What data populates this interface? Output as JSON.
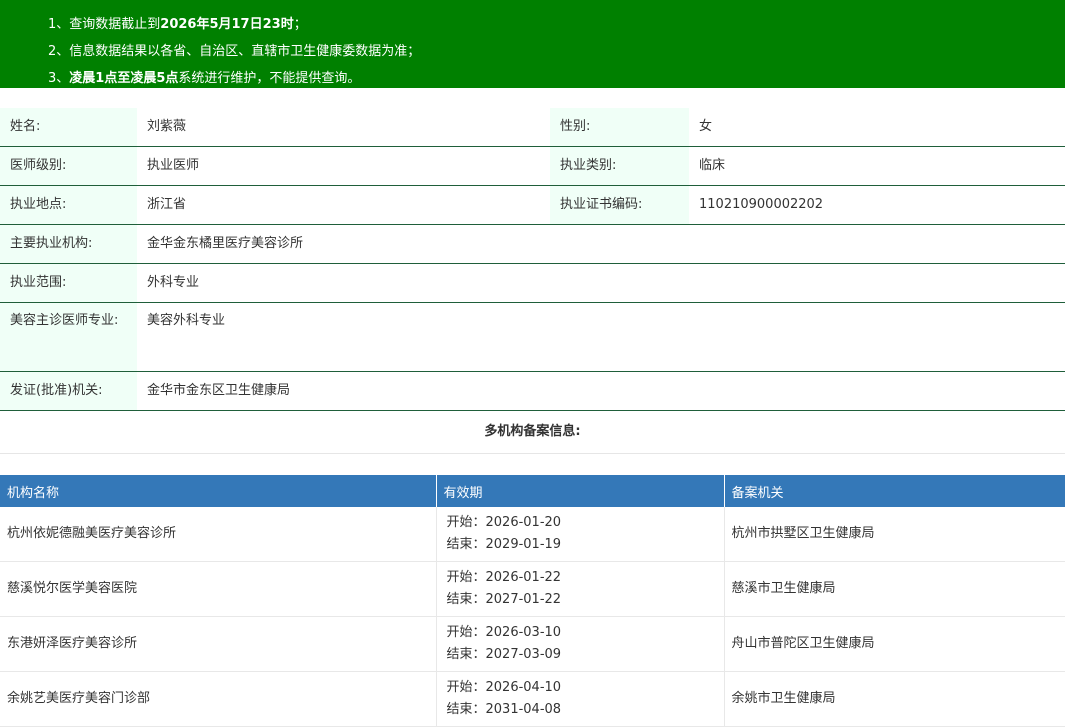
{
  "notice": {
    "line1_prefix": "1、查询数据截止到",
    "line1_bold": "2026年5月17日23时",
    "line1_suffix": "；",
    "line2": "2、信息数据结果以各省、自治区、直辖市卫生健康委数据为准；",
    "line3_prefix": "3、",
    "line3_bold": "凌晨1点至凌晨5点",
    "line3_suffix": "系统进行维护，不能提供查询。"
  },
  "info": {
    "name_label": "姓名:",
    "name": "刘紫薇",
    "gender_label": "性别:",
    "gender": "女",
    "level_label": "医师级别:",
    "level": "执业医师",
    "category_label": "执业类别:",
    "category": "临床",
    "location_label": "执业地点:",
    "location": "浙江省",
    "cert_label": "执业证书编码:",
    "cert": "110210900002202",
    "org_label": "主要执业机构:",
    "org": "金华金东橘里医疗美容诊所",
    "scope_label": "执业范围:",
    "scope": "外科专业",
    "cosmetic_label": "美容主诊医师专业:",
    "cosmetic": "美容外科专业",
    "issuer_label": "发证(批准)机关:",
    "issuer": "金华市金东区卫生健康局"
  },
  "multi": {
    "title": "多机构备案信息:",
    "headers": [
      "机构名称",
      "有效期",
      "备案机关"
    ],
    "start_prefix": "开始：",
    "end_prefix": "结束：",
    "rows": [
      {
        "name": "杭州依妮德融美医疗美容诊所",
        "start": "2026-01-20",
        "end": "2029-01-19",
        "authority": "杭州市拱墅区卫生健康局"
      },
      {
        "name": "慈溪悦尔医学美容医院",
        "start": "2026-01-22",
        "end": "2027-01-22",
        "authority": "慈溪市卫生健康局"
      },
      {
        "name": "东港妍泽医疗美容诊所",
        "start": "2026-03-10",
        "end": "2027-03-09",
        "authority": "舟山市普陀区卫生健康局"
      },
      {
        "name": "余姚艺美医疗美容门诊部",
        "start": "2026-04-10",
        "end": "2031-04-08",
        "authority": "余姚市卫生健康局"
      }
    ]
  }
}
